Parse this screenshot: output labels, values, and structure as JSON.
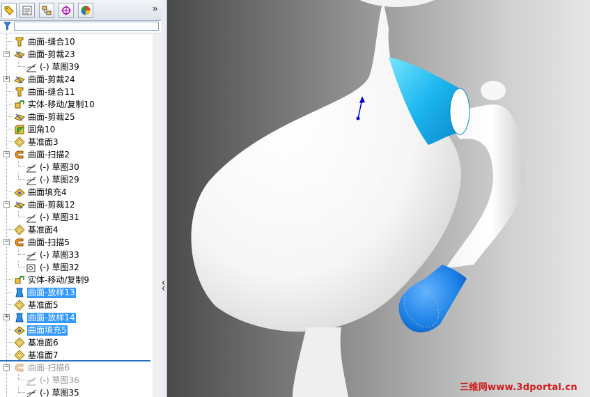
{
  "toolbar": {
    "tabs": [
      {
        "icon": "feature-manager-icon",
        "active": true
      },
      {
        "icon": "property-manager-icon",
        "active": false
      },
      {
        "icon": "configuration-manager-icon",
        "active": false
      },
      {
        "icon": "dimxpert-icon",
        "active": false
      },
      {
        "icon": "display-manager-icon",
        "active": false
      }
    ],
    "more": "»"
  },
  "tree": {
    "items": [
      {
        "label": "曲面-缝合10",
        "icon": "knit-surface-icon"
      },
      {
        "label": "曲面-剪裁23",
        "icon": "trim-surface-icon",
        "expanded": true
      },
      {
        "label": "(-) 草图39",
        "icon": "sketch-icon"
      },
      {
        "label": "曲面-剪裁24",
        "icon": "trim-surface-icon",
        "collapsed": true
      },
      {
        "label": "曲面-缝合11",
        "icon": "knit-surface-icon"
      },
      {
        "label": "实体-移动/复制10",
        "icon": "move-copy-icon"
      },
      {
        "label": "曲面-剪裁25",
        "icon": "trim-surface-icon"
      },
      {
        "label": "圆角10",
        "icon": "fillet-icon"
      },
      {
        "label": "基准面3",
        "icon": "plane-icon"
      },
      {
        "label": "曲面-扫描2",
        "icon": "sweep-surface-icon",
        "expanded": true
      },
      {
        "label": "(-) 草图30",
        "icon": "sketch-icon"
      },
      {
        "label": "(-) 草图29",
        "icon": "sketch-icon"
      },
      {
        "label": "曲面填充4",
        "icon": "fill-surface-icon"
      },
      {
        "label": "曲面-剪裁12",
        "icon": "trim-surface-icon",
        "expanded": true
      },
      {
        "label": "(-) 草图31",
        "icon": "sketch-icon"
      },
      {
        "label": "基准面4",
        "icon": "plane-icon"
      },
      {
        "label": "曲面-扫描5",
        "icon": "sweep-surface-icon",
        "expanded": true
      },
      {
        "label": "(-) 草图33",
        "icon": "sketch-icon"
      },
      {
        "label": "(-) 草图32",
        "icon": "sketch-point-icon"
      },
      {
        "label": "实体-移动/复制9",
        "icon": "move-copy-icon"
      },
      {
        "label": "曲面-放样13",
        "icon": "loft-surface-icon",
        "selected": true
      },
      {
        "label": "基准面5",
        "icon": "plane-icon"
      },
      {
        "label": "曲面-放样14",
        "icon": "loft-surface-icon",
        "selected": true,
        "collapsed": true
      },
      {
        "label": "曲面填充5",
        "icon": "fill-surface-icon",
        "selected": true
      },
      {
        "label": "基准面6",
        "icon": "plane-icon"
      },
      {
        "label": "基准面7",
        "icon": "plane-icon"
      },
      {
        "label": "曲面-扫描6",
        "icon": "sweep-surface-icon",
        "dim": true,
        "expanded": true
      },
      {
        "label": "(-) 草图36",
        "icon": "sketch-icon",
        "dim": true
      },
      {
        "label": "(-) 草图35",
        "icon": "sketch-icon"
      }
    ]
  },
  "viewport": {
    "watermark": "三维网www.3dportal.cn",
    "highlight_color": "#22b8f0"
  }
}
